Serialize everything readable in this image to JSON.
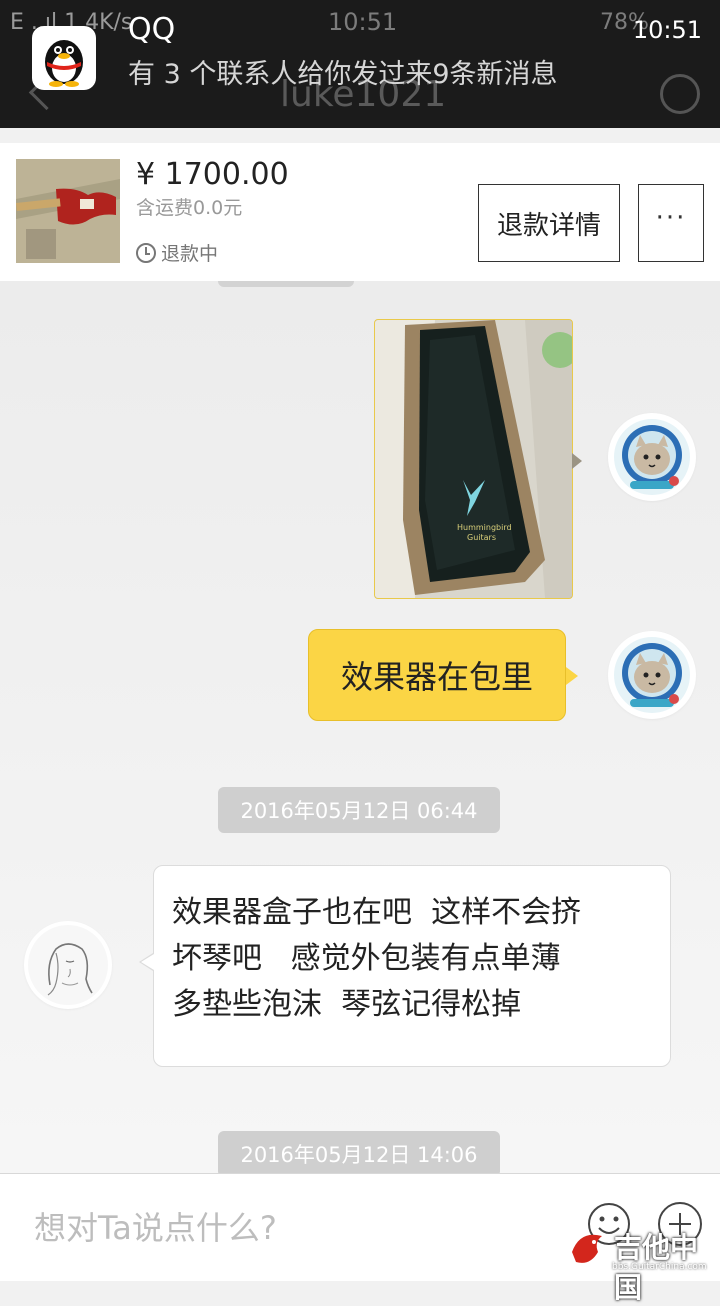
{
  "status_bar": {
    "left_text": "E ..ıl 1.4K/s",
    "time_center": "10:51",
    "battery": "78%",
    "time_right": "10:51"
  },
  "notification": {
    "app_name": "QQ",
    "message": "有 3 个联系人给你发过来9条新消息"
  },
  "header": {
    "title": "luke1021"
  },
  "order": {
    "price": "¥ 1700.00",
    "shipping": "含运费0.0元",
    "status": "退款中",
    "refund_button": "退款详情",
    "more_button": "···"
  },
  "messages": {
    "self_text": "效果器在包里",
    "timestamp1": "2016年05月12日 06:44",
    "other_lines": [
      "效果器盒子也在吧  这样不会挤",
      "坏琴吧   感觉外包装有点单薄",
      "多垫些泡沫  琴弦记得松掉"
    ],
    "timestamp2": "2016年05月12日 14:06"
  },
  "input": {
    "placeholder": "想对Ta说点什么?"
  },
  "photo_text": {
    "line1": "Hummingbird",
    "line2": "Guitars"
  },
  "watermark": {
    "text": "吉他中国",
    "sub": "bbs.GuitarChina.com"
  },
  "colors": {
    "self_bubble": "#fbd545",
    "timestamp_bg": "#cfcfcf",
    "status_bar": "#1b1b1b"
  }
}
